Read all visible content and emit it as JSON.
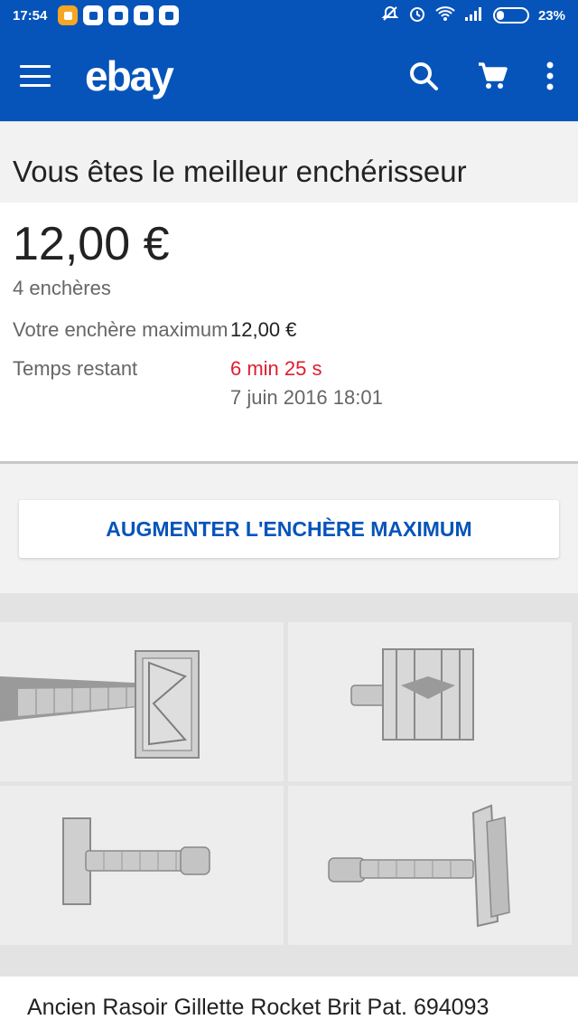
{
  "status_bar": {
    "time": "17:54",
    "battery": "23%"
  },
  "app_bar": {
    "logo": "ebay"
  },
  "header": {
    "title": "Vous êtes le meilleur enchérisseur"
  },
  "bid": {
    "current_price": "12,00 €",
    "bid_count": "4 enchères",
    "max_bid_label": "Votre enchère maximum",
    "max_bid_value": "12,00 €",
    "time_left_label": "Temps restant",
    "time_left_value": "6 min 25 s",
    "end_date": "7 juin 2016 18:01"
  },
  "actions": {
    "increase_max_bid": "AUGMENTER L'ENCHÈRE MAXIMUM"
  },
  "item": {
    "title": "Ancien Rasoir Gillette Rocket Brit Pat. 694093"
  },
  "colors": {
    "brand_blue": "#0654ba",
    "time_left_red": "#dd1e31"
  }
}
